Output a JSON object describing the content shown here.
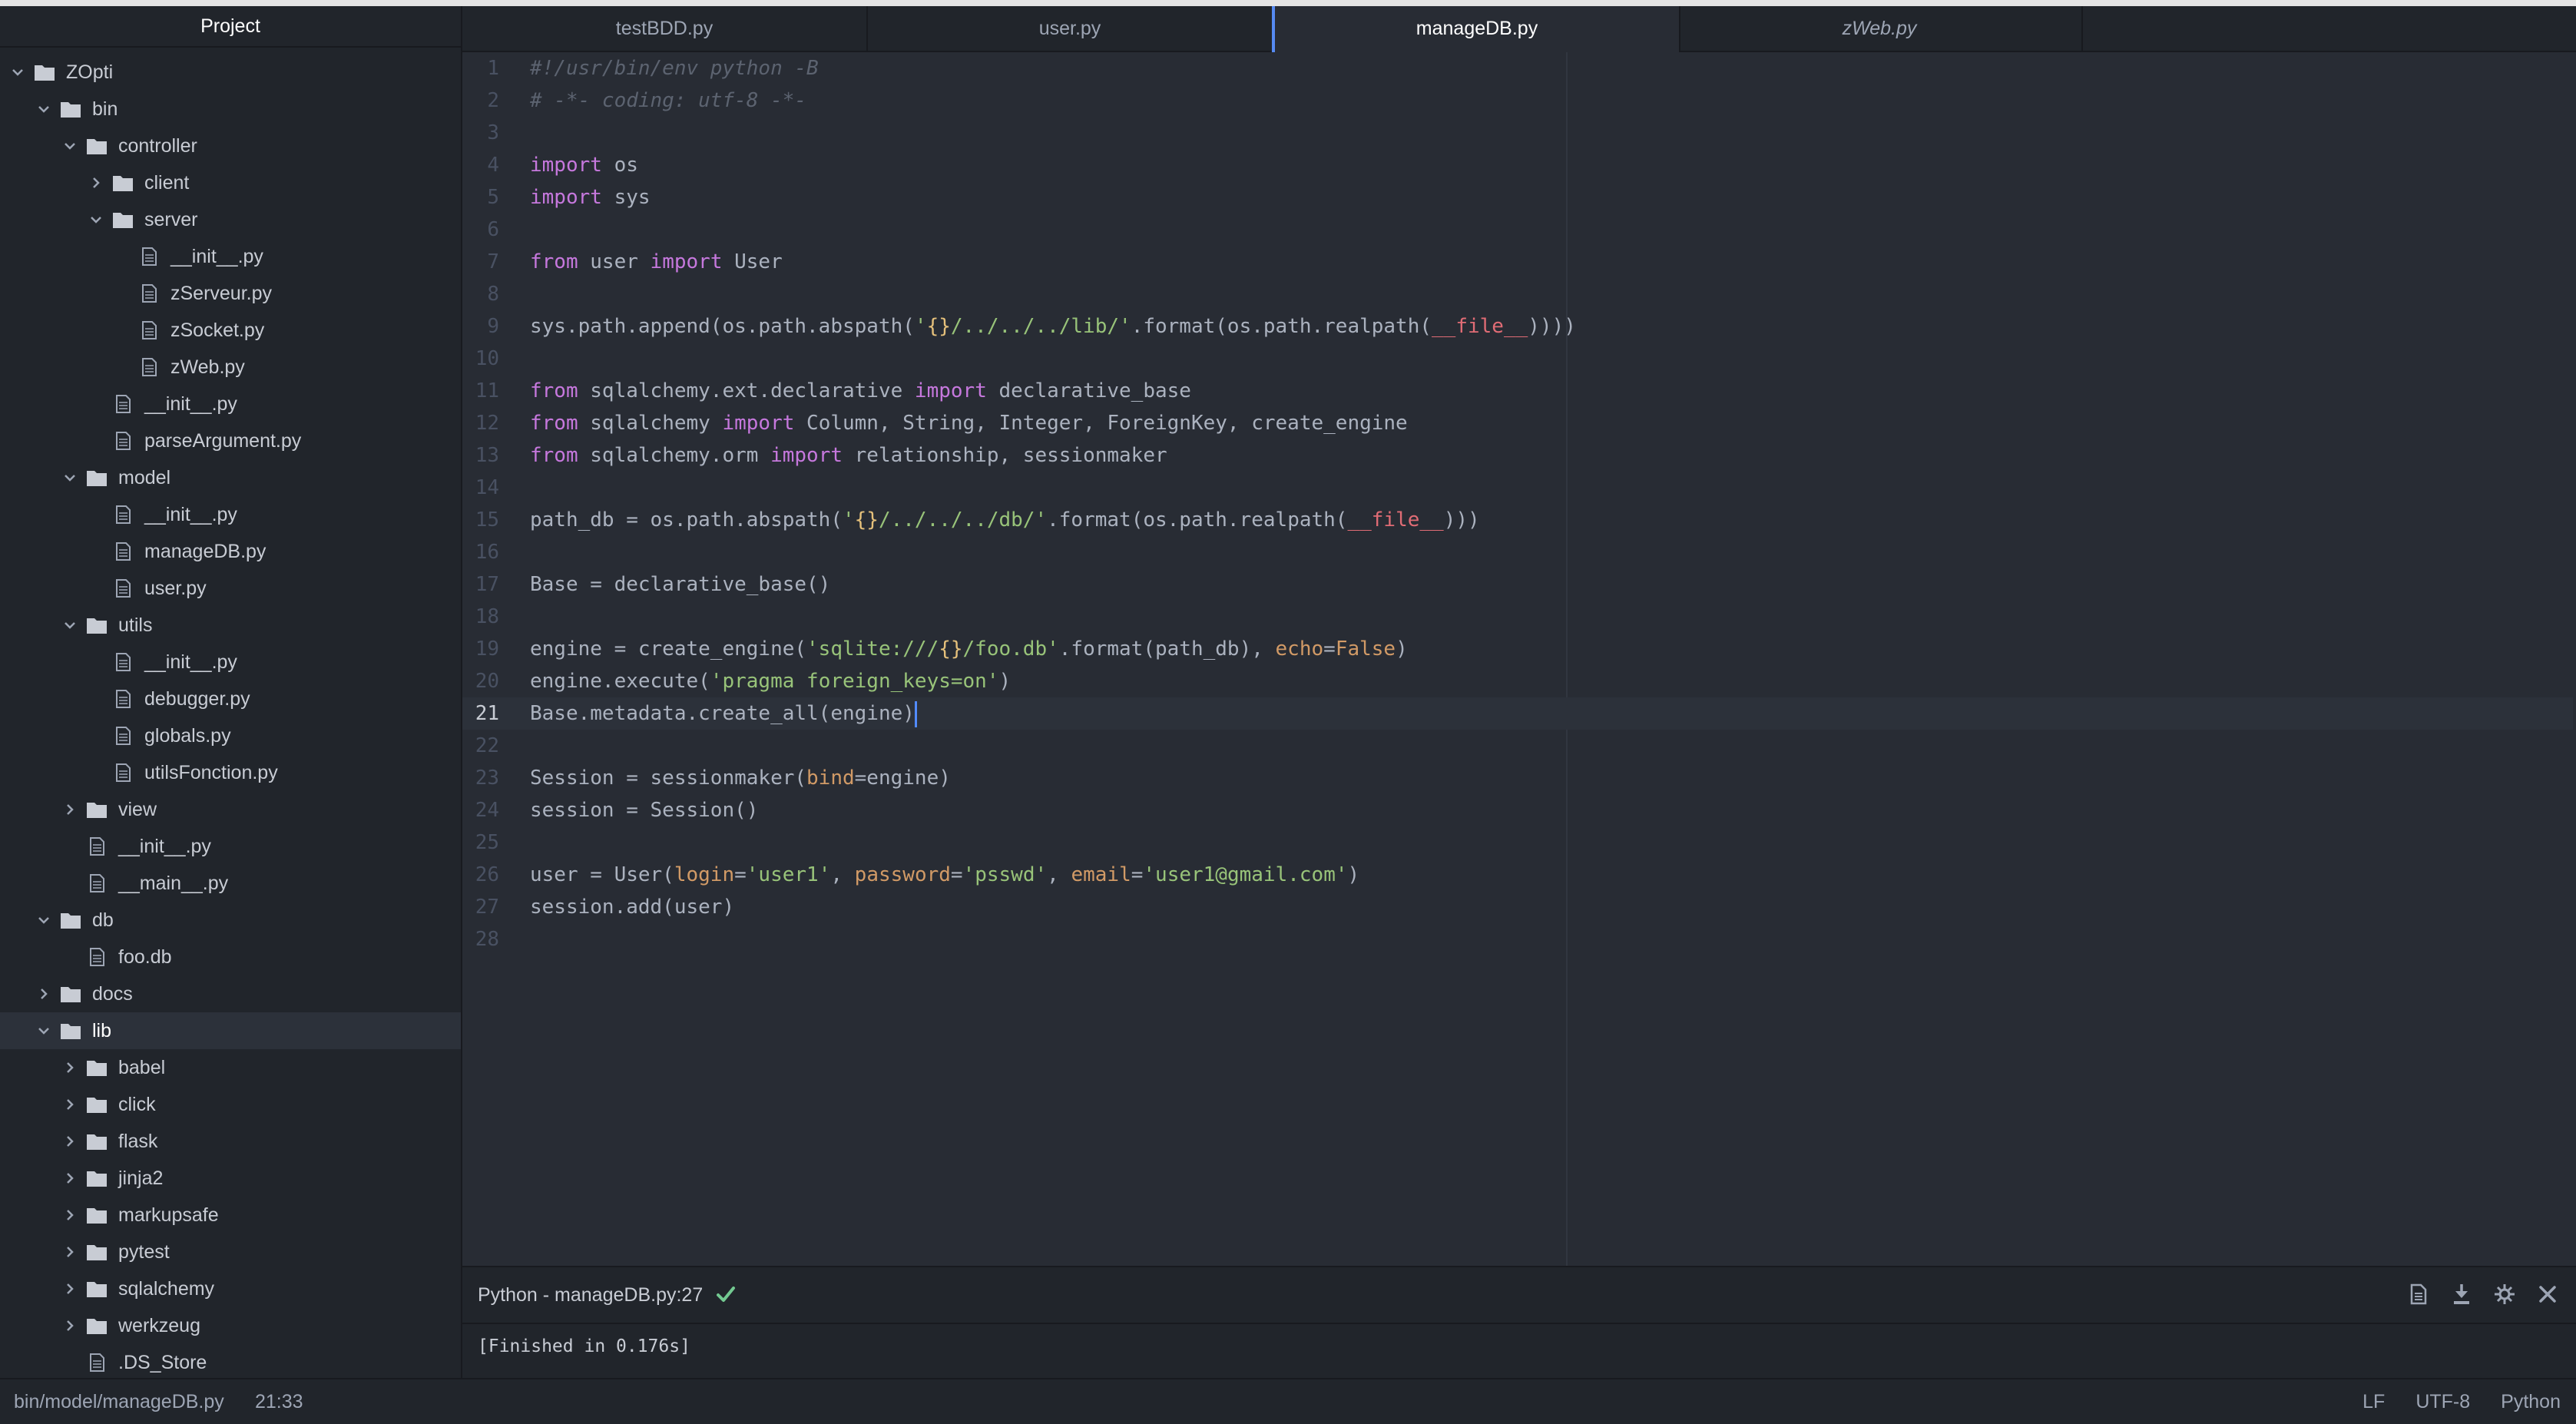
{
  "sidebar": {
    "title": "Project",
    "tree": [
      {
        "label": "ZOpti",
        "type": "folder",
        "depth": 0,
        "expanded": true
      },
      {
        "label": "bin",
        "type": "folder",
        "depth": 1,
        "expanded": true
      },
      {
        "label": "controller",
        "type": "folder",
        "depth": 2,
        "expanded": true
      },
      {
        "label": "client",
        "type": "folder",
        "depth": 3,
        "expanded": false
      },
      {
        "label": "server",
        "type": "folder",
        "depth": 3,
        "expanded": true
      },
      {
        "label": "__init__.py",
        "type": "file",
        "depth": 4
      },
      {
        "label": "zServeur.py",
        "type": "file",
        "depth": 4
      },
      {
        "label": "zSocket.py",
        "type": "file",
        "depth": 4
      },
      {
        "label": "zWeb.py",
        "type": "file",
        "depth": 4
      },
      {
        "label": "__init__.py",
        "type": "file",
        "depth": 3
      },
      {
        "label": "parseArgument.py",
        "type": "file",
        "depth": 3
      },
      {
        "label": "model",
        "type": "folder",
        "depth": 2,
        "expanded": true
      },
      {
        "label": "__init__.py",
        "type": "file",
        "depth": 3
      },
      {
        "label": "manageDB.py",
        "type": "file",
        "depth": 3
      },
      {
        "label": "user.py",
        "type": "file",
        "depth": 3
      },
      {
        "label": "utils",
        "type": "folder",
        "depth": 2,
        "expanded": true
      },
      {
        "label": "__init__.py",
        "type": "file",
        "depth": 3
      },
      {
        "label": "debugger.py",
        "type": "file",
        "depth": 3
      },
      {
        "label": "globals.py",
        "type": "file",
        "depth": 3
      },
      {
        "label": "utilsFonction.py",
        "type": "file",
        "depth": 3
      },
      {
        "label": "view",
        "type": "folder",
        "depth": 2,
        "expanded": false
      },
      {
        "label": "__init__.py",
        "type": "file",
        "depth": 2
      },
      {
        "label": "__main__.py",
        "type": "file",
        "depth": 2
      },
      {
        "label": "db",
        "type": "folder",
        "depth": 1,
        "expanded": true
      },
      {
        "label": "foo.db",
        "type": "file",
        "depth": 2
      },
      {
        "label": "docs",
        "type": "folder",
        "depth": 1,
        "expanded": false
      },
      {
        "label": "lib",
        "type": "folder",
        "depth": 1,
        "expanded": true,
        "selected": true
      },
      {
        "label": "babel",
        "type": "folder",
        "depth": 2,
        "expanded": false
      },
      {
        "label": "click",
        "type": "folder",
        "depth": 2,
        "expanded": false
      },
      {
        "label": "flask",
        "type": "folder",
        "depth": 2,
        "expanded": false
      },
      {
        "label": "jinja2",
        "type": "folder",
        "depth": 2,
        "expanded": false
      },
      {
        "label": "markupsafe",
        "type": "folder",
        "depth": 2,
        "expanded": false
      },
      {
        "label": "pytest",
        "type": "folder",
        "depth": 2,
        "expanded": false
      },
      {
        "label": "sqlalchemy",
        "type": "folder",
        "depth": 2,
        "expanded": false
      },
      {
        "label": "werkzeug",
        "type": "folder",
        "depth": 2,
        "expanded": false
      },
      {
        "label": ".DS_Store",
        "type": "file",
        "depth": 2
      }
    ]
  },
  "tabs": [
    {
      "label": "testBDD.py",
      "active": false,
      "italic": false
    },
    {
      "label": "user.py",
      "active": false,
      "italic": false
    },
    {
      "label": "manageDB.py",
      "active": true,
      "italic": false
    },
    {
      "label": "zWeb.py",
      "active": false,
      "italic": true
    }
  ],
  "editor": {
    "current_line": 21,
    "lines": [
      [
        [
          "cm",
          "#!/usr/bin/env python -B"
        ]
      ],
      [
        [
          "cm",
          "# -*- coding: utf-8 -*-"
        ]
      ],
      [],
      [
        [
          "kw",
          "import"
        ],
        [
          "",
          "  os"
        ]
      ],
      [
        [
          "kw",
          "import"
        ],
        [
          "",
          "  sys"
        ]
      ],
      [],
      [
        [
          "kw",
          "from"
        ],
        [
          "",
          "  user "
        ],
        [
          "kw",
          "import"
        ],
        [
          "",
          "  User"
        ]
      ],
      [],
      [
        [
          "",
          "sys.path.append(os.path.abspath("
        ],
        [
          "str",
          "'"
        ],
        [
          "br",
          "{}"
        ],
        [
          "str",
          "/../../../lib/'"
        ],
        [
          "",
          ".format(os.path.realpath("
        ],
        [
          "dd",
          "__file__"
        ],
        [
          "",
          "))))"
        ]
      ],
      [],
      [
        [
          "kw",
          "from"
        ],
        [
          "",
          "  sqlalchemy.ext.declarative "
        ],
        [
          "kw",
          "import"
        ],
        [
          "",
          "  declarative_base"
        ]
      ],
      [
        [
          "kw",
          "from"
        ],
        [
          "",
          "  sqlalchemy "
        ],
        [
          "kw",
          "import"
        ],
        [
          "",
          "  Column, String, Integer, ForeignKey, create_engine"
        ]
      ],
      [
        [
          "kw",
          "from"
        ],
        [
          "",
          "  sqlalchemy.orm "
        ],
        [
          "kw",
          "import"
        ],
        [
          "",
          "  relationship, sessionmaker"
        ]
      ],
      [],
      [
        [
          "",
          "path_db = os.path.abspath("
        ],
        [
          "str",
          "'"
        ],
        [
          "br",
          "{}"
        ],
        [
          "str",
          "/../../../db/'"
        ],
        [
          "",
          ".format(os.path.realpath("
        ],
        [
          "dd",
          "__file__"
        ],
        [
          "",
          ")))"
        ]
      ],
      [],
      [
        [
          "",
          "Base = declarative_base()"
        ]
      ],
      [],
      [
        [
          "",
          "engine = create_engine("
        ],
        [
          "str",
          "'sqlite:///"
        ],
        [
          "br",
          "{}"
        ],
        [
          "str",
          "/foo.db'"
        ],
        [
          "",
          ".format(path_db), "
        ],
        [
          "kwarg",
          "echo"
        ],
        [
          "",
          "="
        ],
        [
          "kwarg",
          "False"
        ],
        [
          "",
          ")"
        ]
      ],
      [
        [
          "",
          "engine.execute("
        ],
        [
          "str",
          "'pragma foreign_keys=on'"
        ],
        [
          "",
          ")"
        ]
      ],
      [
        [
          "",
          "Base.metadata.create_all(engine)"
        ]
      ],
      [],
      [
        [
          "",
          "Session = sessionmaker("
        ],
        [
          "kwarg",
          "bind"
        ],
        [
          "",
          "=engine)"
        ]
      ],
      [
        [
          "",
          "session = Session()"
        ]
      ],
      [],
      [
        [
          "",
          "user = User("
        ],
        [
          "kwarg",
          "login"
        ],
        [
          "",
          "="
        ],
        [
          "str",
          "'user1'"
        ],
        [
          "",
          ", "
        ],
        [
          "kwarg",
          "password"
        ],
        [
          "",
          "="
        ],
        [
          "str",
          "'psswd'"
        ],
        [
          "",
          ", "
        ],
        [
          "kwarg",
          "email"
        ],
        [
          "",
          "="
        ],
        [
          "str",
          "'user1@gmail.com'"
        ],
        [
          "",
          ")"
        ]
      ],
      [
        [
          "",
          "session.add(user)"
        ]
      ],
      []
    ]
  },
  "panel": {
    "title": "Python - manageDB.py:27",
    "status_icon": "check-icon",
    "output": "[Finished in 0.176s]",
    "actions": [
      "file-icon",
      "download-icon",
      "settings-icon",
      "close-icon"
    ]
  },
  "statusbar": {
    "path": "bin/model/manageDB.py",
    "position": "21:33",
    "line_ending": "LF",
    "encoding": "UTF-8",
    "grammar": "Python"
  },
  "colors": {
    "accent": "#568af2",
    "check": "#73c991",
    "folder_icon": "#c8ccd4"
  }
}
